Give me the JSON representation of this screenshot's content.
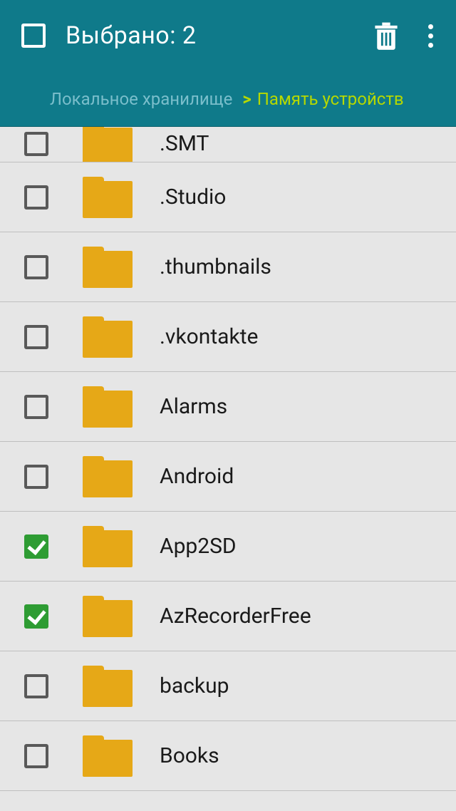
{
  "appbar": {
    "title": "Выбрано: 2"
  },
  "breadcrumb": {
    "crumb1": "Локальное хранилище",
    "sep": ">",
    "crumb2": "Память устройств"
  },
  "folders": [
    {
      "name": ".SMT",
      "checked": false,
      "cut": true
    },
    {
      "name": ".Studio",
      "checked": false
    },
    {
      "name": ".thumbnails",
      "checked": false
    },
    {
      "name": ".vkontakte",
      "checked": false
    },
    {
      "name": "Alarms",
      "checked": false
    },
    {
      "name": "Android",
      "checked": false
    },
    {
      "name": "App2SD",
      "checked": true
    },
    {
      "name": "AzRecorderFree",
      "checked": true
    },
    {
      "name": "backup",
      "checked": false
    },
    {
      "name": "Books",
      "checked": false
    }
  ]
}
